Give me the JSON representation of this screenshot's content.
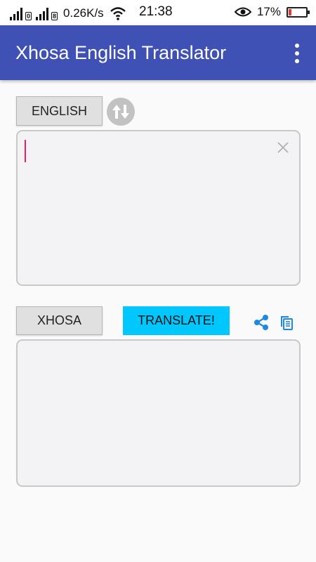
{
  "status_bar": {
    "sim1_tag": "0",
    "sim2_tag": "8",
    "network_speed": "0.26K/s",
    "time": "21:38",
    "battery_percent": "17%",
    "battery_level": 0.17,
    "battery_color": "#e53935",
    "icons": [
      "signal-icon",
      "signal-icon",
      "wifi-icon",
      "eye-icon",
      "battery-icon"
    ]
  },
  "app_bar": {
    "title": "Xhosa English Translator",
    "background": "#3f51b5",
    "menu_icon": "more-vert-icon"
  },
  "source": {
    "language_label": "ENGLISH",
    "input_value": "",
    "swap_icon": "swap-vert-icon",
    "clear_icon": "close-icon"
  },
  "target": {
    "language_label": "XHOSA",
    "translate_label": "TRANSLATE!",
    "translate_color": "#00c8ff",
    "output_value": "",
    "share_icon": "share-icon",
    "copy_icon": "copy-icon",
    "action_icon_color": "#1e88e5"
  }
}
